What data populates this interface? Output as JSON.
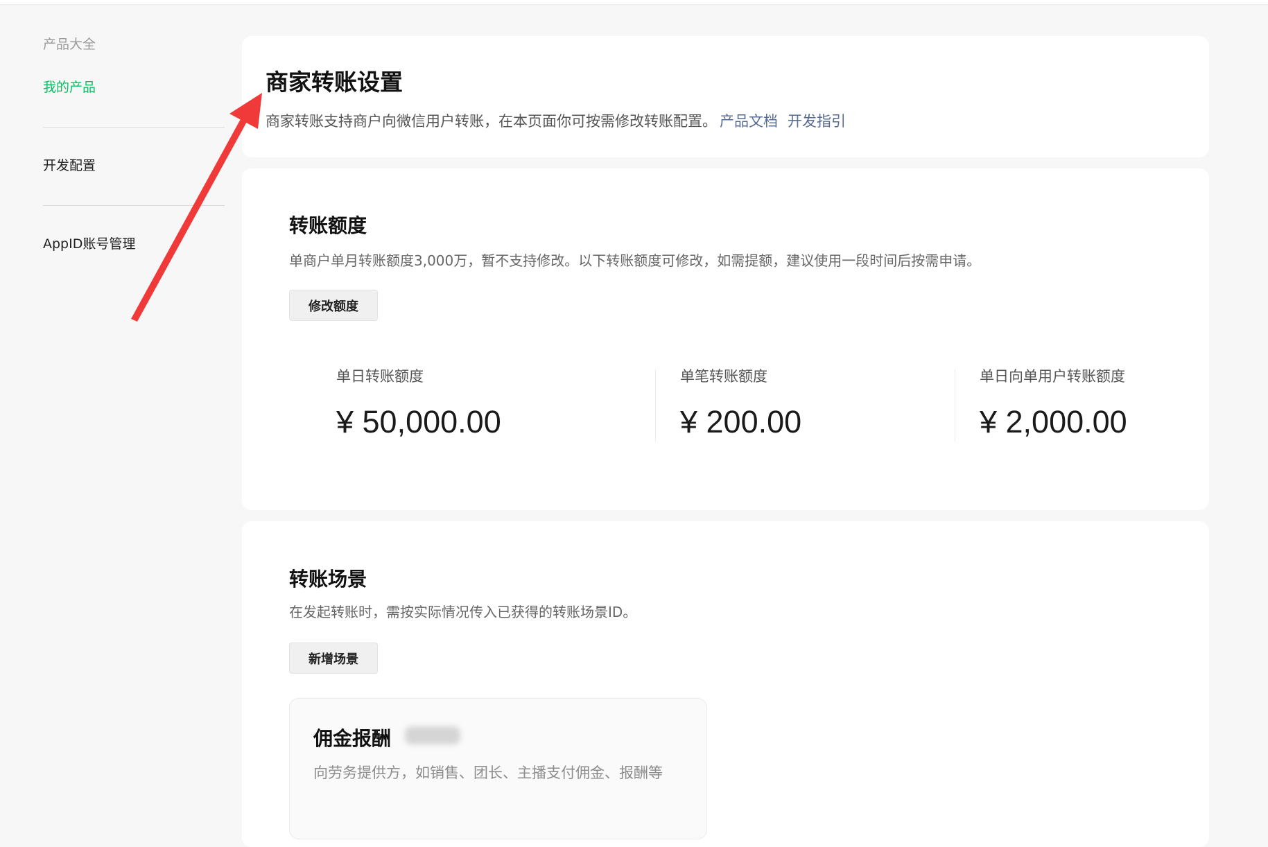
{
  "sidebar": {
    "category_label": "产品大全",
    "my_products": "我的产品",
    "dev_config": "开发配置",
    "appid_mgmt": "AppID账号管理"
  },
  "header": {
    "title": "商家转账设置",
    "description": "商家转账支持商户向微信用户转账，在本页面你可按需修改转账配置。",
    "links": [
      "产品文档",
      "开发指引"
    ]
  },
  "quota": {
    "title": "转账额度",
    "description": "单商户单月转账额度3,000万，暂不支持修改。以下转账额度可修改，如需提额，建议使用一段时间后按需申请。",
    "button": "修改额度",
    "stats": [
      {
        "label": "单日转账额度",
        "value": "¥ 50,000.00"
      },
      {
        "label": "单笔转账额度",
        "value": "¥ 200.00"
      },
      {
        "label": "单日向单用户转账额度",
        "value": "¥ 2,000.00"
      }
    ]
  },
  "scenes": {
    "title": "转账场景",
    "description": "在发起转账时，需按实际情况传入已获得的转账场景ID。",
    "button": "新增场景",
    "items": [
      {
        "name": "佣金报酬",
        "description": "向劳务提供方，如销售、团长、主播支付佣金、报酬等"
      }
    ]
  },
  "colors": {
    "accent_green": "#07c160",
    "link_blue": "#576b95",
    "annotation_red": "#f03a3a"
  }
}
